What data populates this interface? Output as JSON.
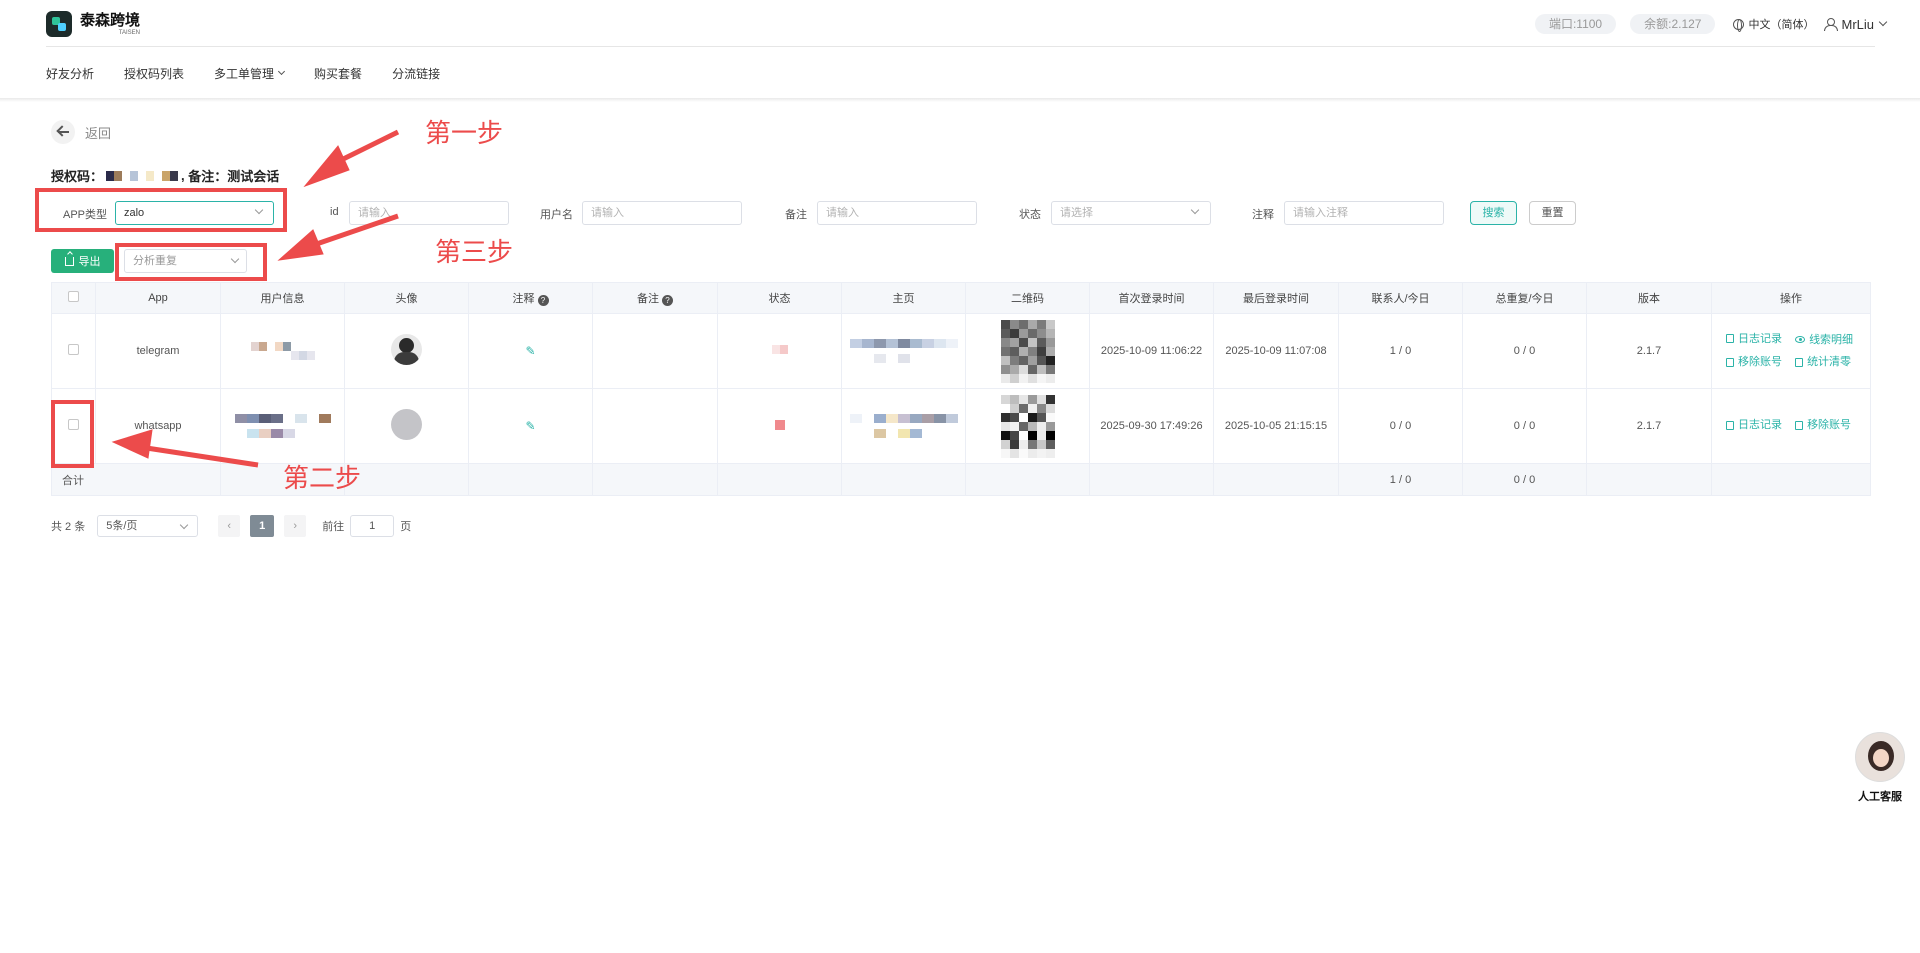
{
  "header": {
    "logo_name": "泰森跨境",
    "logo_sub": "TAISEN",
    "port_label": "端口:1100",
    "balance_label": "余额:2.127",
    "language": "中文（简体）",
    "username": "MrLiu"
  },
  "nav": {
    "items": [
      {
        "label": "好友分析"
      },
      {
        "label": "授权码列表"
      },
      {
        "label": "多工单管理"
      },
      {
        "label": "购买套餐"
      },
      {
        "label": "分流链接"
      }
    ]
  },
  "back": {
    "label": "返回"
  },
  "auth": {
    "code_label": "授权码：",
    "remark_label": "备注：",
    "remark_value": "测试会话"
  },
  "filters": {
    "app_type_label": "APP类型",
    "app_type_value": "zalo",
    "id_label": "id",
    "id_placeholder": "请输入",
    "username_label": "用户名",
    "username_placeholder": "请输入",
    "remark_label": "备注",
    "remark_placeholder": "请输入",
    "status_label": "状态",
    "status_placeholder": "请选择",
    "note_label": "注释",
    "note_placeholder": "请输入注释",
    "search_label": "搜索",
    "reset_label": "重置"
  },
  "toolbar": {
    "export_label": "导出",
    "analyze_placeholder": "分析重复"
  },
  "table": {
    "headers": {
      "app": "App",
      "user_info": "用户信息",
      "avatar": "头像",
      "note": "注释",
      "remark": "备注",
      "status": "状态",
      "homepage": "主页",
      "qrcode": "二维码",
      "first_login": "首次登录时间",
      "last_login": "最后登录时间",
      "contacts": "联系人/今日",
      "replies": "总重复/今日",
      "version": "版本",
      "actions": "操作"
    },
    "rows": [
      {
        "app": "telegram",
        "first_login": "2025-10-09 11:06:22",
        "last_login": "2025-10-09 11:07:08",
        "contacts": "1 / 0",
        "replies": "0 / 0",
        "version": "2.1.7",
        "actions": [
          "日志记录",
          "线索明细",
          "移除账号",
          "统计清零"
        ]
      },
      {
        "app": "whatsapp",
        "first_login": "2025-09-30 17:49:26",
        "last_login": "2025-10-05 21:15:15",
        "contacts": "0 / 0",
        "replies": "0 / 0",
        "version": "2.1.7",
        "actions": [
          "日志记录",
          "移除账号"
        ]
      }
    ],
    "summary": {
      "label": "合计",
      "contacts": "1 / 0",
      "replies": "0 / 0"
    }
  },
  "pager": {
    "total": "共 2 条",
    "page_size": "5条/页",
    "current": "1",
    "goto_label": "前往",
    "goto_value": "1",
    "page_suffix": "页"
  },
  "annotations": {
    "step1": "第一步",
    "step2": "第二步",
    "step3": "第三步"
  },
  "support": {
    "label": "人工客服"
  },
  "colors": {
    "accent": "#2bb3a8",
    "export": "#27b07b",
    "annotation": "#ec4b4b"
  }
}
